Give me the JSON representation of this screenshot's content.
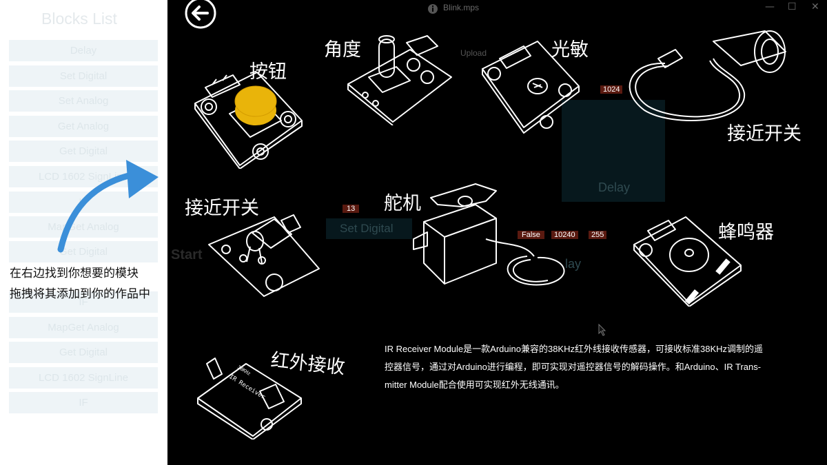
{
  "app": {
    "file_title": "Blink.mps",
    "window_controls": [
      "—",
      "☐",
      "✕"
    ],
    "ghost_labels": {
      "upload": "Upload",
      "start": "Start",
      "set_digital": "Set Digital",
      "delay": "Delay",
      "delay2": "lay",
      "chip_13": "13",
      "chip_false": "False",
      "chip_10240": "10240",
      "chip_255": "255",
      "chip_1024": "1024"
    }
  },
  "sidebar": {
    "title": "Blocks List",
    "blocks": [
      "Delay",
      "Set Digital",
      "Set Analog",
      "Get Analog",
      "Get Digital",
      "LCD 1602 SignLine",
      "IF",
      "MapGet Analog",
      "Get Digital",
      "",
      "IF",
      "MapGet Analog",
      "Get Digital",
      "LCD 1602 SignLine",
      "IF"
    ],
    "hint_line1": "在右边找到你想要的模块",
    "hint_line2": "拖拽将其添加到你的作品中"
  },
  "modules": {
    "button": "按钮",
    "angle": "角度",
    "light": "光敏",
    "proximity_top": "接近开关",
    "proximity_left": "接近开关",
    "servo": "舵机",
    "buzzer": "蜂鸣器",
    "ir_receiver": "红外接收",
    "ir_board_text": "IR Receiver",
    "ir_board_code": "38KHz"
  },
  "description": {
    "line1": "IR Receiver Module是一款Arduino兼容的38KHz红外线接收传感器，可接收标准38KHz调制的遥",
    "line2": "控器信号，通过对Arduino进行编程，即可实现对遥控器信号的解码操作。和Arduino、IR Trans-",
    "line3": "mitter Module配合使用可实现红外无线通讯。"
  },
  "colors": {
    "background": "#000000",
    "button_cap": "#e9b40a",
    "arrow": "#3b8fd9",
    "sidebar_bg": "#ffffff",
    "block_bg": "#eef4f7"
  }
}
